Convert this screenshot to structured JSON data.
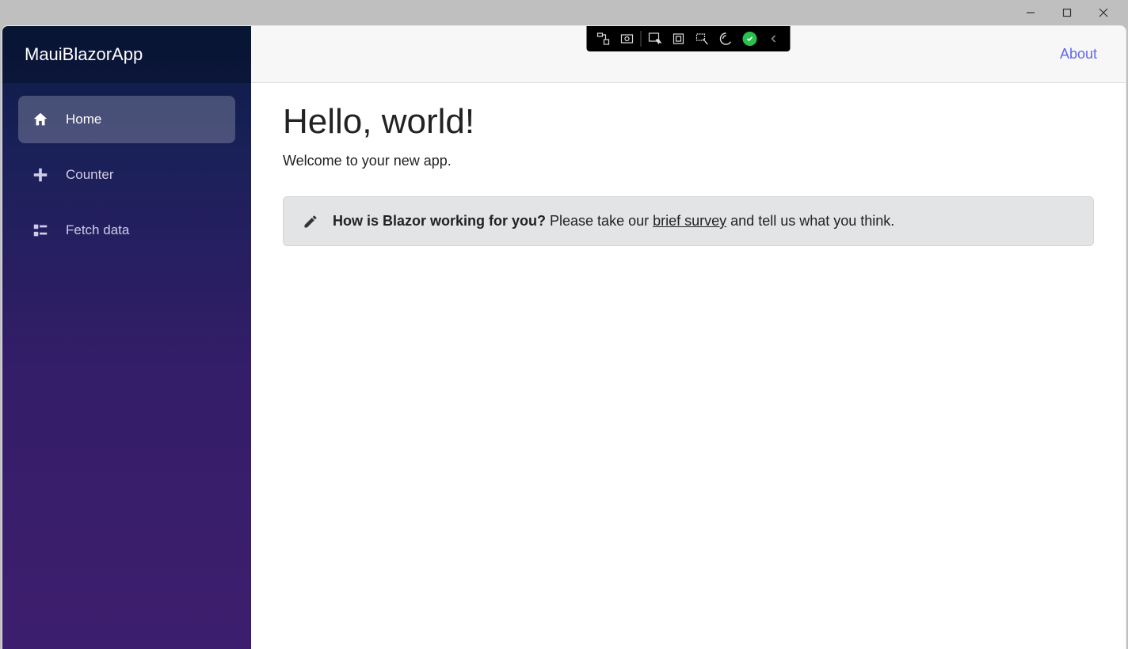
{
  "window": {
    "minimize_label": "Minimize",
    "maximize_label": "Maximize",
    "close_label": "Close"
  },
  "sidebar": {
    "brand": "MauiBlazorApp",
    "items": [
      {
        "label": "Home",
        "icon": "home-icon",
        "active": true
      },
      {
        "label": "Counter",
        "icon": "plus-icon",
        "active": false
      },
      {
        "label": "Fetch data",
        "icon": "list-icon",
        "active": false
      }
    ]
  },
  "topbar": {
    "about_link": "About"
  },
  "main": {
    "heading": "Hello, world!",
    "welcome": "Welcome to your new app.",
    "survey": {
      "question": "How is Blazor working for you?",
      "prefix": " Please take our ",
      "link_text": "brief survey",
      "suffix": " and tell us what you think."
    }
  },
  "debug_toolbar": {
    "icons": [
      "live-visual-tree-icon",
      "screenshot-icon",
      "select-element-icon",
      "layout-adorners-icon",
      "track-focus-icon",
      "hot-reload-icon",
      "status-ok-icon",
      "collapse-chevron-icon"
    ]
  }
}
